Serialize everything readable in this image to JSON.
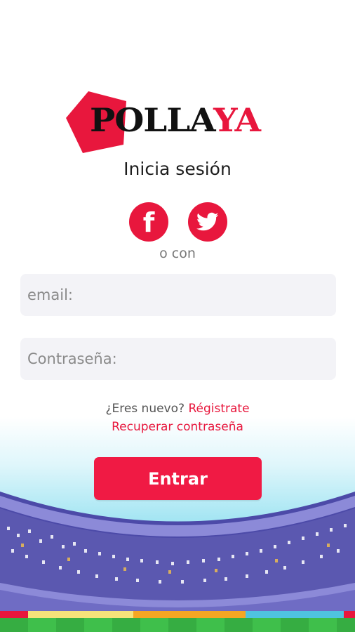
{
  "brand": {
    "part1": "POLLA",
    "part2": "YA",
    "accent_color": "#e8173d"
  },
  "title": "Inicia sesión",
  "social": [
    {
      "name": "facebook",
      "icon": "facebook-icon",
      "glyph": "f"
    },
    {
      "name": "twitter",
      "icon": "twitter-icon"
    }
  ],
  "alt_login": "o con",
  "form": {
    "email_placeholder": "email:",
    "password_placeholder": "Contraseña:"
  },
  "new_user": {
    "prompt": "¿Eres nuevo?",
    "register_link": "Régistrate"
  },
  "recover_link": "Recuperar contraseña",
  "submit_label": "Entrar",
  "colors": {
    "primary": "#f01a44",
    "field_bg": "#f3f3f7",
    "sky": "#57cfe8",
    "crowd": "#5b58b0",
    "grass": "#3fbf4b"
  }
}
